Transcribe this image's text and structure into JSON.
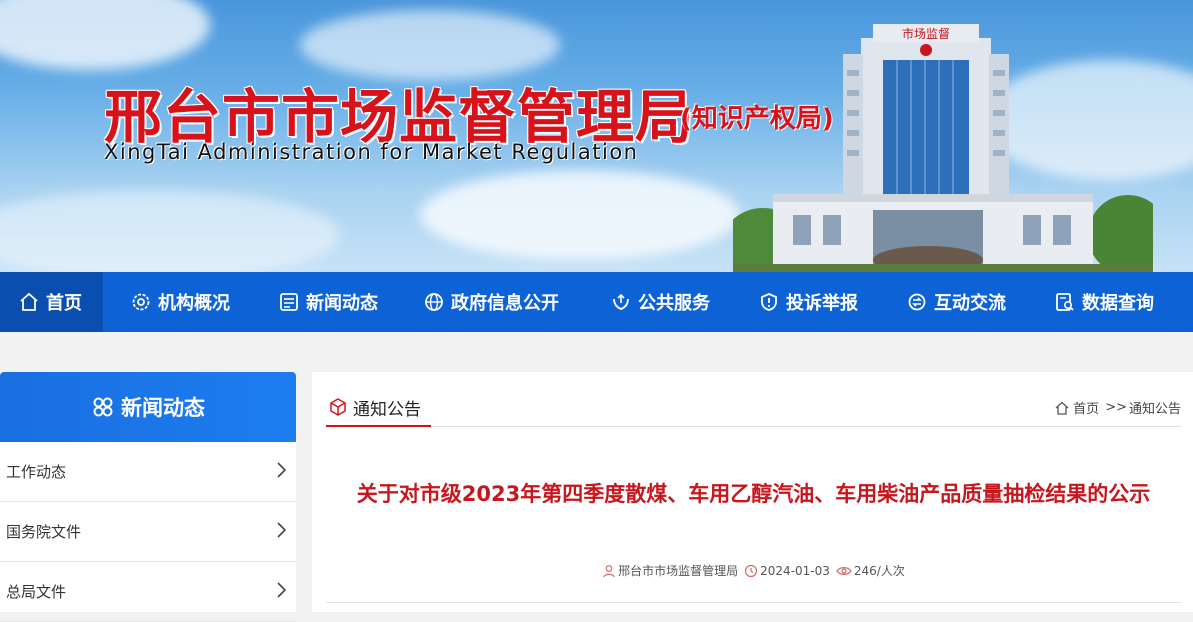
{
  "banner": {
    "title_cn": "邢台市市场监督管理局",
    "title_sub": "(知识产权局)",
    "title_en": "XingTai Administration for Market Regulation",
    "building_sign": "市场监督"
  },
  "nav": {
    "items": [
      {
        "label": "首页",
        "icon": "home-icon"
      },
      {
        "label": "机构概况",
        "icon": "gear-icon"
      },
      {
        "label": "新闻动态",
        "icon": "news-icon"
      },
      {
        "label": "政府信息公开",
        "icon": "globe-icon"
      },
      {
        "label": "公共服务",
        "icon": "hands-icon"
      },
      {
        "label": "投诉举报",
        "icon": "shield-icon"
      },
      {
        "label": "互动交流",
        "icon": "exchange-icon"
      },
      {
        "label": "数据查询",
        "icon": "data-search-icon"
      }
    ]
  },
  "sidebar": {
    "title": "新闻动态",
    "items": [
      {
        "label": "工作动态"
      },
      {
        "label": "国务院文件"
      },
      {
        "label": "总局文件"
      }
    ]
  },
  "content": {
    "tab_label": "通知公告",
    "breadcrumb_home": "首页",
    "breadcrumb_sep": ">>",
    "breadcrumb_current": "通知公告",
    "article_title": "关于对市级2023年第四季度散煤、车用乙醇汽油、车用柴油产品质量抽检结果的公示",
    "meta_source": "邢台市市场监督管理局",
    "meta_date": "2024-01-03",
    "meta_views": "246/人次"
  },
  "colors": {
    "nav_blue": "#0d63d6",
    "nav_active": "#0a4fb0",
    "title_red": "#c8161d"
  }
}
